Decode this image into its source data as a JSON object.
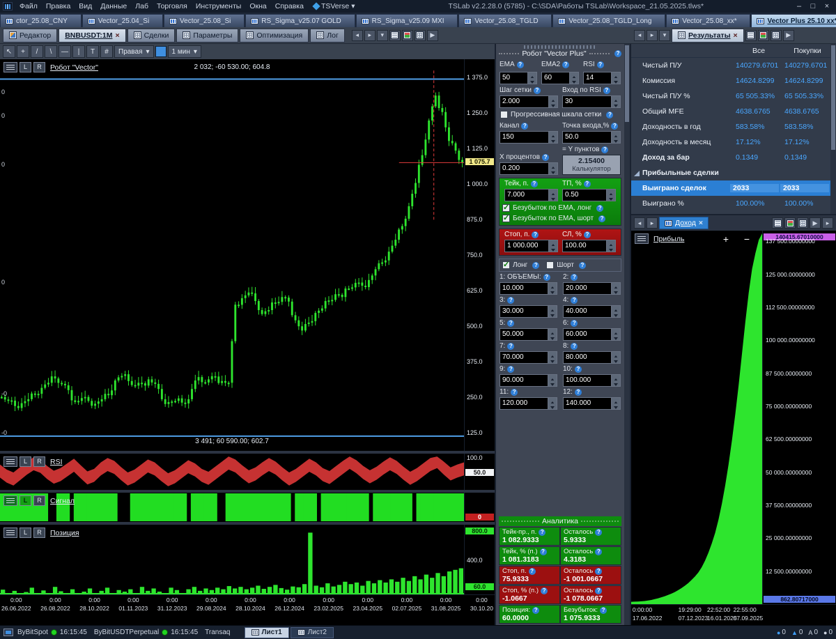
{
  "icons": {
    "close": "×",
    "minimize": "–",
    "maximize": "□",
    "dropdown": "▾",
    "scroll_left": "◂",
    "scroll_right": "▸",
    "play": "▶",
    "step": "▸▸",
    "plus": "+",
    "minus": "−"
  },
  "titlebar": {
    "title": "TSLab v2.2.28.0 (5785) - C:\\SDA\\Работы TSLab\\Workspace_21.05.2025.tlws*",
    "menus": [
      "Файл",
      "Правка",
      "Вид",
      "Данные",
      "Лаб",
      "Торговля",
      "Инструменты",
      "Окна",
      "Справка"
    ],
    "tsverse": "TSVerse"
  },
  "workspace_tabs": [
    {
      "label": "ctor_25.08_CNY"
    },
    {
      "label": "Vector_25.04_Si"
    },
    {
      "label": "Vector_25.08_Si"
    },
    {
      "label": "RS_Sigma_v25.07 GOLD"
    },
    {
      "label": "RS_Sigma_v25.09 MXI"
    },
    {
      "label": "Vector_25.08_TGLD"
    },
    {
      "label": "Vector_25.08_TGLD_Long"
    },
    {
      "label": "Vector_25.08_xx*"
    },
    {
      "label": "Vector Plus 25.10 xx*",
      "active": true
    }
  ],
  "doc_toolbar": {
    "editor_tab": "Редактор",
    "chart_tab": "BNBUSDT:1M",
    "view_tabs": [
      {
        "label": "Сделки"
      },
      {
        "label": "Параметры"
      },
      {
        "label": "Оптимизация"
      },
      {
        "label": "Лог"
      }
    ],
    "results_tab": "Результаты"
  },
  "chart_toolbar": {
    "tools": [
      {
        "glyph": "↖"
      },
      {
        "glyph": "+"
      },
      {
        "glyph": "/"
      },
      {
        "glyph": "\\"
      },
      {
        "glyph": "—"
      },
      {
        "glyph": "|"
      },
      {
        "glyph": "T"
      },
      {
        "glyph": "#"
      }
    ],
    "axis_dropdown": "Правая",
    "interval_dropdown": "1 мин"
  },
  "price_panel": {
    "robot_label": "Робот \"Vector\"",
    "top_annotation": "2 032; -60 530.00; 604.8",
    "bottom_annotation": "3 491; 60 590.00; 602.7",
    "current_price": "1 075.7",
    "axis_labels": [
      "1 375.0",
      "1 250.0",
      "1 125.0",
      "1 000.0",
      "875.0",
      "750.0",
      "625.0",
      "500.0",
      "375.0",
      "250.0",
      "125.0"
    ],
    "left_ticks": [
      {
        "t": "0",
        "y": 0.075
      },
      {
        "t": "0",
        "y": 0.135
      },
      {
        "t": "0",
        "y": 0.26
      },
      {
        "t": "0",
        "y": 0.56
      },
      {
        "t": "-0",
        "y": 0.845
      },
      {
        "t": "-0",
        "y": 0.945
      }
    ]
  },
  "rsi_panel": {
    "label": "RSI",
    "axis_top": "100.0",
    "badge": "50.0"
  },
  "signal_panel": {
    "label": "Сигнал",
    "badge": "0"
  },
  "position_panel": {
    "label": "Позиция",
    "axis_top": "800.0",
    "axis_mid": "400.0",
    "axis_bottom": "60.0"
  },
  "xaxis_ticks": [
    {
      "time": "0:00",
      "date": "26.06.2022"
    },
    {
      "time": "0:00",
      "date": "26.08.2022"
    },
    {
      "time": "0:00",
      "date": "28.10.2022"
    },
    {
      "time": "0:00",
      "date": "01.11.2023"
    },
    {
      "time": "0:00",
      "date": "31.12.2023"
    },
    {
      "time": "0:00",
      "date": "29.08.2024"
    },
    {
      "time": "0:00",
      "date": "28.10.2024"
    },
    {
      "time": "0:00",
      "date": "26.12.2024"
    },
    {
      "time": "0:00",
      "date": "23.02.2025"
    },
    {
      "time": "0:00",
      "date": "23.04.2025"
    },
    {
      "time": "0:00",
      "date": "02.07.2025"
    },
    {
      "time": "0:00",
      "date": "31.08.2025"
    },
    {
      "time": "0:00",
      "date": "30.10.20"
    }
  ],
  "robot_panel": {
    "title": "Робот \"Vector Plus\"",
    "ema_label": "EMA",
    "ema": "50",
    "ema2_label": "EMA2",
    "ema2": "60",
    "rsi_label": "RSI",
    "rsi": "14",
    "grid_step_label": "Шаг сетки",
    "grid_step": "2.000",
    "rsi_entry_label": "Вход по RSI",
    "rsi_entry": "30",
    "progressive_label": "Прогрессивная шкала сетки",
    "progressive_checked": false,
    "channel_label": "Канал",
    "channel": "150",
    "entry_point_label": "Точка входа,%",
    "entry_point": "50.0",
    "x_percent_label": "Х процентов",
    "x_percent": "0.200",
    "y_points_label": "= Y пунктов",
    "y_points": "2.15400",
    "calculator_label": "Калькулятор",
    "take_label": "Тейк, п.",
    "take": "7.000",
    "tp_label": "ТП, %",
    "tp": "0.50",
    "be_long_label": "Безубыток по EMA, лонг",
    "be_long_checked": true,
    "be_short_label": "Безубыток по EMA, шорт",
    "be_short_checked": true,
    "stop_label": "Стоп, п.",
    "stop": "1 000.000",
    "sl_label": "СЛ, %",
    "sl": "100.00",
    "long_label": "Лонг",
    "long_checked": true,
    "short_label": "Шорт",
    "short_checked": false,
    "volumes": [
      {
        "label": "1: ОБЪЕМЫ:",
        "value": "10.000"
      },
      {
        "label": "2:",
        "value": "20.000"
      },
      {
        "label": "3:",
        "value": "30.000"
      },
      {
        "label": "4:",
        "value": "40.000"
      },
      {
        "label": "5:",
        "value": "50.000"
      },
      {
        "label": "6:",
        "value": "60.000"
      },
      {
        "label": "7:",
        "value": "70.000"
      },
      {
        "label": "8:",
        "value": "80.000"
      },
      {
        "label": "9:",
        "value": "90.000"
      },
      {
        "label": "10:",
        "value": "100.000"
      },
      {
        "label": "11:",
        "value": "120.000"
      },
      {
        "label": "12:",
        "value": "140.000"
      }
    ]
  },
  "analytics": {
    "title": "Аналитика",
    "rows": [
      {
        "label": "Тейк-пр., п.",
        "value": "1 082.9333",
        "label2": "Осталось",
        "value2": "5.9333",
        "green": true
      },
      {
        "label": "Тейк, % (п.)",
        "value": "1 081.3183",
        "label2": "Осталось",
        "value2": "4.3183",
        "green": true
      },
      {
        "label": "Стоп, п.",
        "value": "75.9333",
        "label2": "Осталось",
        "value2": "-1 001.0667",
        "red": true
      },
      {
        "label": "Стоп, % (п.)",
        "value": "-1.0667",
        "label2": "Осталось",
        "value2": "-1 078.0667",
        "red": true
      },
      {
        "label": "Позиция:",
        "value": "60.0000",
        "label2": "Безубыток:",
        "value2": "1 075.9333",
        "green": true
      }
    ]
  },
  "results": {
    "col_all": "Все",
    "col_buys": "Покупки",
    "rows": [
      {
        "label": "Чистый П/У",
        "all": "140279.6701",
        "buys": "140279.6701"
      },
      {
        "label": "Комиссия",
        "all": "14624.8299",
        "buys": "14624.8299"
      },
      {
        "label": "Чистый П/У %",
        "all": "65 505.33%",
        "buys": "65 505.33%"
      },
      {
        "label": "Общий MFE",
        "all": "4638.6765",
        "buys": "4638.6765"
      },
      {
        "label": "Доходность в год",
        "all": "583.58%",
        "buys": "583.58%"
      },
      {
        "label": "Доходность в месяц",
        "all": "17.12%",
        "buys": "17.12%"
      },
      {
        "label": "Доход за бар",
        "all": "0.1349",
        "buys": "0.1349",
        "bold": true
      },
      {
        "label": "Прибыльные сделки",
        "all": "",
        "buys": "",
        "group": true
      },
      {
        "label": "Выиграно сделок",
        "all": "2033",
        "buys": "2033",
        "selected": true
      },
      {
        "label": "Выиграно %",
        "all": "100.00%",
        "buys": "100.00%"
      }
    ]
  },
  "equity_panel": {
    "tab": "Доход",
    "series_label": "Прибыль",
    "max_badge": "140415.67010000",
    "min_badge": "862.80717000",
    "axis_labels": [
      "137 500.00000000",
      "125 000.00000000",
      "112 500.00000000",
      "100 000.00000000",
      "87 500.00000000",
      "75 000.00000000",
      "62 500.00000000",
      "50 000.00000000",
      "37 500.00000000",
      "25 000.00000000",
      "12 500.00000000"
    ],
    "x_ticks": [
      {
        "time": "0:00:00",
        "date": "17.06.2022",
        "x": 0.01
      },
      {
        "time": "19:29:00",
        "date": "07.12.2023",
        "x": 0.36
      },
      {
        "time": "22:52:00",
        "date": "16.01.2025",
        "x": 0.58
      },
      {
        "time": "22:55:00",
        "date": "07.09.2025",
        "x": 0.78
      }
    ]
  },
  "statusbar": {
    "connections": [
      {
        "name": "ByBitSpot",
        "time": "16:15:45",
        "dot": true
      },
      {
        "name": "ByBitUSDTPerpetual",
        "time": "16:15:45",
        "dot": true
      },
      {
        "name": "Transaq",
        "time": ""
      }
    ],
    "sheets": [
      {
        "label": "Лист1",
        "active": true
      },
      {
        "label": "Лист2"
      }
    ],
    "counters": [
      {
        "glyph": "●",
        "count": "0",
        "blue": true
      },
      {
        "glyph": "▲",
        "count": "0",
        "blue": true
      },
      {
        "glyph": "A",
        "count": "0"
      },
      {
        "glyph": "●",
        "count": "0"
      }
    ]
  },
  "chart_data": [
    {
      "type": "candlestick",
      "name": "BNBUSDT:1M price",
      "ylim": [
        60,
        1440
      ],
      "color": "#2ee52e",
      "channel_top": 1370,
      "channel_bottom": 112,
      "last_price": 1075.7,
      "marker_x": 0.935,
      "closes": [
        250,
        238,
        218,
        228,
        242,
        258,
        282,
        300,
        315,
        296,
        274,
        232,
        246,
        236,
        226,
        242,
        256,
        308,
        324,
        306,
        290,
        298,
        312,
        296,
        242,
        232,
        236,
        230,
        242,
        308,
        302,
        312,
        322,
        306,
        300,
        575,
        598,
        618,
        588,
        542,
        556,
        580,
        602,
        586,
        520,
        484,
        512,
        546,
        562,
        590,
        612,
        602,
        632,
        652,
        642,
        662,
        700,
        724,
        762,
        804,
        852,
        922,
        1004,
        1102,
        1224,
        1312,
        1254,
        1152,
        1118,
        1076
      ]
    },
    {
      "type": "band",
      "name": "RSI",
      "ylim": [
        0,
        100
      ],
      "color": "#c63232",
      "values": [
        52,
        38,
        30,
        45,
        60,
        72,
        65,
        48,
        35,
        42,
        55,
        68,
        50,
        33,
        40,
        58,
        70,
        62,
        45,
        30,
        38,
        52,
        66,
        58,
        42,
        28,
        36,
        50,
        64,
        55,
        40,
        32,
        46,
        60,
        74,
        66,
        50,
        36,
        44,
        58,
        70,
        60,
        44,
        30,
        40,
        54,
        68,
        58,
        42,
        34,
        48,
        62,
        76,
        64,
        48,
        36,
        46,
        60,
        72,
        62,
        46,
        32,
        42,
        56,
        70,
        78,
        60,
        44,
        52,
        58
      ]
    },
    {
      "type": "binary-bars",
      "name": "Сигнал",
      "color": "#22dd22",
      "pattern": "11111111111001110111111111100011111111111110111111001111111111111110111110111111111110111111111011111111111"
    },
    {
      "type": "histogram",
      "name": "Позиция",
      "ylim": [
        0,
        880
      ],
      "color": "#2ee52e",
      "values": [
        60,
        0,
        45,
        0,
        30,
        85,
        0,
        50,
        0,
        95,
        40,
        0,
        65,
        0,
        35,
        75,
        0,
        45,
        85,
        0,
        55,
        35,
        65,
        0,
        95,
        45,
        75,
        35,
        0,
        85,
        55,
        0,
        65,
        95,
        45,
        75,
        55,
        85,
        65,
        105,
        75,
        95,
        65,
        85,
        110,
        70,
        95,
        120,
        80,
        60,
        100,
        90,
        130,
        780,
        110,
        90,
        140,
        100,
        120,
        160,
        130,
        150,
        110,
        170,
        140,
        180,
        150,
        190,
        160,
        210,
        170,
        230,
        190,
        250,
        210,
        270,
        230,
        290,
        310,
        330
      ]
    },
    {
      "type": "area",
      "name": "Доход (Прибыль)",
      "ylim": [
        0,
        141500
      ],
      "color": "#2ee52e",
      "values": [
        900,
        950,
        1000,
        1100,
        1200,
        1400,
        1600,
        1900,
        2200,
        2600,
        3000,
        3500,
        4000,
        4600,
        5300,
        6100,
        7000,
        8000,
        9200,
        10500,
        12000,
        14000,
        16500,
        19500,
        23000,
        27000,
        32000,
        38000,
        45000,
        53000,
        62000,
        72000,
        83000,
        95000,
        107000,
        118000,
        127000,
        133000,
        138000,
        140415.67
      ]
    }
  ]
}
